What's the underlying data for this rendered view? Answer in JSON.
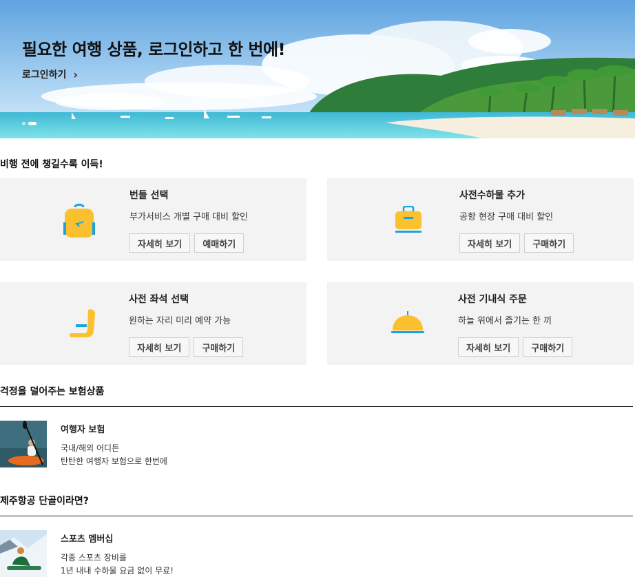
{
  "hero": {
    "title": "필요한 여행 상품, 로그인하고 한 번에!",
    "login_label": "로그인하기",
    "chevron_glyph": "›",
    "slides_count": 2,
    "active_slide": 2
  },
  "section_ancillary": {
    "title": "비행 전에 챙길수록 이득!"
  },
  "cards": [
    {
      "icon": "backpack-icon",
      "title": "번들 선택",
      "desc": "부가서비스 개별 구매 대비 할인",
      "buttons": [
        "자세히 보기",
        "예매하기"
      ]
    },
    {
      "icon": "suitcase-icon",
      "title": "사전수하물 추가",
      "desc": "공항 현장 구매 대비 할인",
      "buttons": [
        "자세히 보기",
        "구매하기"
      ]
    },
    {
      "icon": "seat-icon",
      "title": "사전 좌석 선택",
      "desc": "원하는 자리 미리 예약 가능",
      "buttons": [
        "자세히 보기",
        "구매하기"
      ]
    },
    {
      "icon": "meal-cloche-icon",
      "title": "사전 기내식 주문",
      "desc": "하늘 위에서 즐기는 한 끼",
      "buttons": [
        "자세히 보기",
        "구매하기"
      ]
    }
  ],
  "section_insurance": {
    "title": "걱정을 덜어주는 보험상품",
    "item": {
      "title": "여행자 보험",
      "line1": "국내/해외 어디든",
      "line2": "탄탄한 여행자 보험으로 한번에"
    }
  },
  "section_member": {
    "title": "제주항공 단골이라면?",
    "item": {
      "title": "스포츠 멤버십",
      "line1": "각종 스포츠 장비를",
      "line2": "1년 내내 수하물 요금 없이 무료!"
    }
  },
  "colors": {
    "accent_yellow": "#fbc02d",
    "accent_blue": "#1ba3dc",
    "card_bg": "#f3f3f3"
  }
}
